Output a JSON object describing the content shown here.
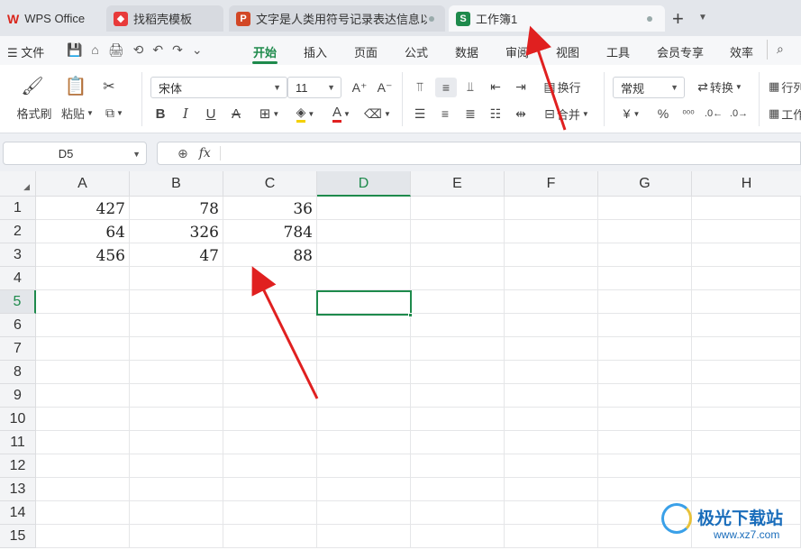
{
  "tabs": [
    {
      "label": "WPS Office",
      "icon": "wps-logo-icon",
      "color": "#d9261c"
    },
    {
      "label": "找稻壳模板",
      "icon": "docer-icon",
      "color": "#e83a3a"
    },
    {
      "label": "文字是人类用符号记录表达信息以",
      "icon": "P",
      "color": "#d24726"
    },
    {
      "label": "工作簿1",
      "icon": "S",
      "color": "#1e8a4c"
    }
  ],
  "new_tab": "+",
  "menu": {
    "file": "文件",
    "items": [
      "开始",
      "插入",
      "页面",
      "公式",
      "数据",
      "审阅",
      "视图",
      "工具",
      "会员专享",
      "效率"
    ],
    "active": "开始"
  },
  "ribbon": {
    "format_painter": "格式刷",
    "paste": "粘贴",
    "font_name": "宋体",
    "font_size": "11",
    "bold": "B",
    "italic": "I",
    "underline": "U",
    "strike": "A",
    "wrap": "换行",
    "merge": "合并",
    "number_format": "常规",
    "convert": "转换",
    "currency": "¥",
    "percent": "%",
    "row_col": "行列",
    "worksheet": "工作"
  },
  "name_box": "D5",
  "fx": "fx",
  "columns": [
    "A",
    "B",
    "C",
    "D",
    "E",
    "F",
    "G",
    "H"
  ],
  "active_column": "D",
  "rows": [
    "1",
    "2",
    "3",
    "4",
    "5",
    "6",
    "7",
    "8",
    "9",
    "10",
    "11",
    "12",
    "13",
    "14",
    "15"
  ],
  "active_row": "5",
  "cells": [
    [
      "427",
      "78",
      "36"
    ],
    [
      "64",
      "326",
      "784"
    ],
    [
      "456",
      "47",
      "88"
    ]
  ],
  "watermark": {
    "name": "极光下载站",
    "url": "www.xz7.com"
  },
  "colors": {
    "accent": "#1e8a4c",
    "annotation": "#e02020"
  }
}
